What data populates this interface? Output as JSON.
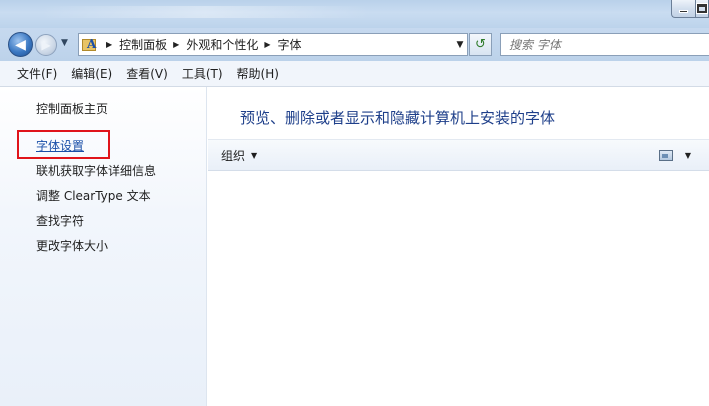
{
  "window": {
    "minimize_icon": "minimize-icon",
    "maximize_icon": "maximize-icon"
  },
  "address_bar": {
    "breadcrumbs": [
      "控制面板",
      "外观和个性化",
      "字体"
    ],
    "folder_icon": "fonts-folder-icon"
  },
  "search": {
    "placeholder": "搜索 字体"
  },
  "menu": {
    "items": [
      "文件(F)",
      "编辑(E)",
      "查看(V)",
      "工具(T)",
      "帮助(H)"
    ]
  },
  "task_pane": {
    "home": "控制面板主页",
    "items": [
      "字体设置",
      "联机获取字体详细信息",
      "调整 ClearType 文本",
      "查找字符",
      "更改字体大小"
    ],
    "highlighted_index": 0
  },
  "main": {
    "title": "预览、删除或者显示和隐藏计算机上安装的字体",
    "organize_label": "组织"
  },
  "colors": {
    "accent_text": "#1e3f8a",
    "link": "#1a4fa8",
    "highlight_border": "#e0141b"
  }
}
